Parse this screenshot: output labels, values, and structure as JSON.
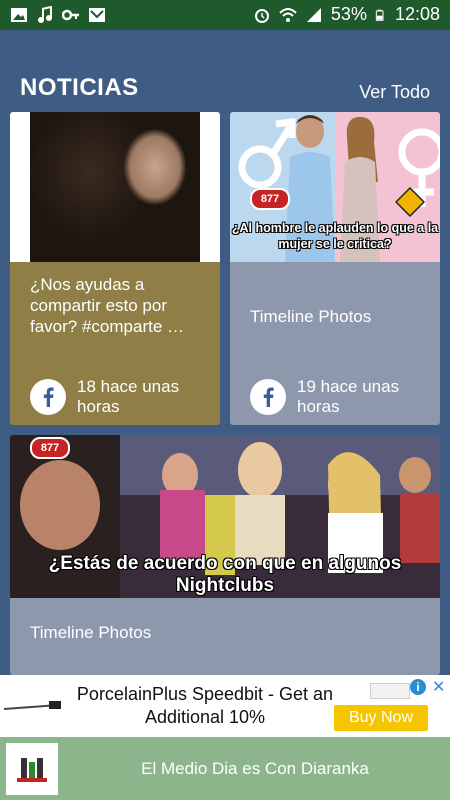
{
  "status_bar": {
    "battery": "53%",
    "time": "12:08",
    "icons": [
      "image-icon",
      "music-icon",
      "key-icon",
      "mail-icon",
      "alarm-icon",
      "wifi-icon",
      "signal-icon",
      "battery-icon"
    ]
  },
  "section": {
    "title": "NOTICIAS",
    "see_all": "Ver Todo"
  },
  "cards": [
    {
      "text": "¿Nos ayudas a compartir esto por favor? #comparte …",
      "time": "18 hace unas horas",
      "source_icon": "facebook-icon"
    },
    {
      "image_caption": "¿Al hombre le aplauden lo que a la mujer se le critica?",
      "text": "Timeline Photos",
      "time": "19 hace unas horas",
      "source_icon": "facebook-icon"
    },
    {
      "image_caption": "¿Estás de acuerdo con que en algunos Nightclubs",
      "text": "Timeline Photos"
    }
  ],
  "ad": {
    "text": "PorcelainPlus Speedbit - Get an Additional 10%",
    "cta": "Buy Now"
  },
  "player": {
    "title": "El Medio Dia es Con Diaranka"
  },
  "colors": {
    "status_bar": "#1f5a2c",
    "background": "#3f5d84",
    "card1": "#8f7e45",
    "card_gray": "#8e98ad",
    "player_bar": "#8db58c",
    "ad_button": "#f5c500"
  }
}
